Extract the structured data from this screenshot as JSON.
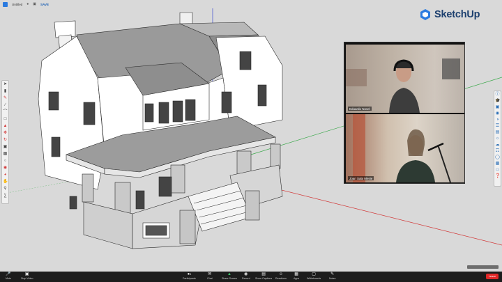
{
  "app": {
    "doc_title": "Untitled",
    "save_label": "SAVE",
    "brand_name": "SketchUp"
  },
  "colors": {
    "brand_blue": "#1c3f6e",
    "leave_red": "#e02828",
    "axis_red": "#d23a3a",
    "axis_green": "#3aa84a",
    "axis_blue": "#3a4bd2"
  },
  "left_toolbar": {
    "tools": [
      "select-icon",
      "eraser-icon",
      "pencil-icon",
      "line-icon",
      "arc-icon",
      "rectangle-icon",
      "push-pull-icon",
      "move-icon",
      "rotate-icon",
      "scale-icon",
      "offset-icon",
      "tape-measure-icon",
      "paint-bucket-icon",
      "orbit-icon",
      "pan-icon",
      "zoom-icon",
      "section-icon"
    ]
  },
  "right_toolbar": {
    "tools": [
      "entity-info-icon",
      "instructor-icon",
      "components-icon",
      "materials-icon",
      "styles-icon",
      "layers-icon",
      "scenes-icon",
      "shadows-icon",
      "fog-icon",
      "outliner-icon",
      "soften-icon",
      "extension-icon",
      "display-icon",
      "help-icon"
    ]
  },
  "video": {
    "participant_1": "Eduardo Nosel",
    "participant_2": "Joan Sala Mesie"
  },
  "zoom_bar": {
    "mute": "Mute",
    "stop_video": "Stop Video",
    "participants": "Participants",
    "participants_count": "3",
    "chat": "Chat",
    "share_screen": "Share Screen",
    "record": "Record",
    "live_captions": "Show Captions",
    "reactions": "Reactions",
    "apps": "Apps",
    "whiteboards": "Whiteboards",
    "notes": "Notes",
    "leave": "Leave"
  }
}
